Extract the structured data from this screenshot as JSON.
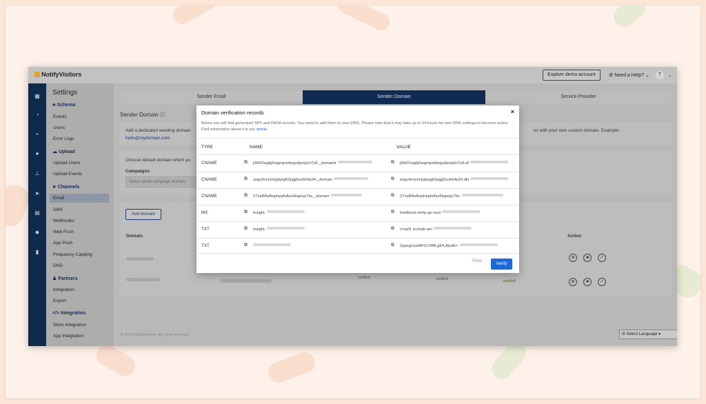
{
  "colors": {
    "accent": "#1e67d6",
    "rail": "#0f2a4a",
    "active_tab": "#102c55",
    "background": "#fbe6d8"
  },
  "topbar": {
    "brand": "NotifyVisitors",
    "explore_label": "Explore demo account",
    "help_label": "Need a Help?",
    "user_initial": "T"
  },
  "rail_icons": [
    "grid-icon",
    "gauge-icon",
    "chart-icon",
    "users-icon",
    "hierarchy-icon",
    "send-icon",
    "document-icon",
    "gear-icon",
    "building-icon"
  ],
  "sidebar": {
    "title": "Settings",
    "schema": "Schema",
    "schema_items": [
      "Events",
      "Users",
      "Error Logs"
    ],
    "upload": "Upload",
    "upload_items": [
      "Upload Users",
      "Upload Events"
    ],
    "channels": "Channels",
    "channel_items": [
      "Email",
      "SMS",
      "Webhooks",
      "Web Push",
      "App Push",
      "Frequency Capping",
      "DND"
    ],
    "partners": "Partners",
    "partner_items": [
      "Integration",
      "Export"
    ],
    "integration": "Integration",
    "integration_items": [
      "Store Integration",
      "App Integration"
    ]
  },
  "main": {
    "tabs": [
      "Sender Email",
      "Sender Domain",
      "Service Provider"
    ],
    "section_title": "Sender Domain",
    "card1_text": "Add a dedicated sending domain",
    "card1_text_right": "es with your own custom domain. Example -",
    "card1_email": "hello@mydomain.com",
    "card2_text": "Choose default domain which yo",
    "campaigns_label": "Campaigns",
    "campaign_placeholder": "Select email campaign domain",
    "add_domain_label": "Add domain",
    "domain_header": "Domain",
    "action_header": "Action",
    "verified_label": "verified",
    "footer": "© 2024 NotifyVisitors. All rights reserved.",
    "select_language": "Select Language"
  },
  "modal": {
    "title": "Domain verification records",
    "close": "×",
    "description": "Below you will find generated SPF and DKIM records. You need to add them to your DNS. Please note that it may take up to 24 hours for new DNS settings to become active. Find information about it in our",
    "article_link": "article",
    "col_type": "TYPE",
    "col_name": "NAME",
    "col_value": "VALUE",
    "rows": [
      {
        "type": "CNAME",
        "name": "j3l422wgbj5wgmjutvbzgvdpxq2ct7y6._domaink",
        "value": "j3l422wgbj5wgmjutvbzgvdpxq2ct7y6.dl"
      },
      {
        "type": "CNAME",
        "name": "zegu4cnckniyjkpig62pgjj5zu664p34._domain",
        "value": "zegu4cnckniyjkpig62pgjj5zu664p34.dkl"
      },
      {
        "type": "CNAME",
        "name": "27vaf6fwfbsphppluflsu6bqwyp7bc._domain",
        "value": "27vaf6fwfbsphppluflsu6bqwyp7bc."
      },
      {
        "type": "MX",
        "name": "insight.",
        "value": "feedback-smtp.ap-sout"
      },
      {
        "type": "TXT",
        "name": "insight.",
        "value": "v=spf1 include:am"
      },
      {
        "type": "TXT",
        "name": "",
        "value": "2ppxgUywNFCrXfMLjpPLAlydE+"
      }
    ],
    "print_label": "Print",
    "verify_label": "Verify"
  }
}
